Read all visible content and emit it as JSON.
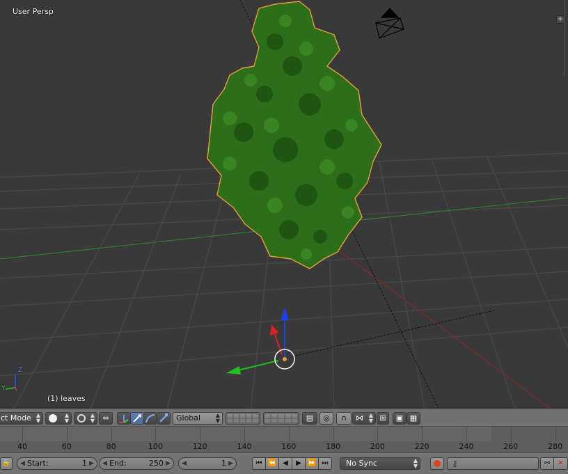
{
  "viewport": {
    "view_name": "User Persp",
    "object_info": "(1) leaves",
    "axis_labels": {
      "y": "Y",
      "z": "Z"
    }
  },
  "header": {
    "mode_label": "ct Mode",
    "orientation_label": "Global"
  },
  "timeline": {
    "ruler_ticks": [
      "40",
      "60",
      "80",
      "100",
      "120",
      "140",
      "160",
      "180",
      "200",
      "220",
      "240",
      "260",
      "280"
    ],
    "start_label": "Start:",
    "start_value": "1",
    "end_label": "End:",
    "end_value": "250",
    "current_frame": "1",
    "sync_label": "No Sync"
  },
  "colors": {
    "viewport_bg": "#393939",
    "grid_line": "#4a4a4a",
    "x_axis": "#8a2a2a",
    "y_axis": "#2f8a2f",
    "foliage": "#2d7a1a",
    "selection_outline": "#e8a03a",
    "gizmo_x": "#e02020",
    "gizmo_y": "#20c020",
    "gizmo_z": "#2040e8",
    "header_bg": "#727272",
    "active_blue": "#5f7fb5"
  }
}
